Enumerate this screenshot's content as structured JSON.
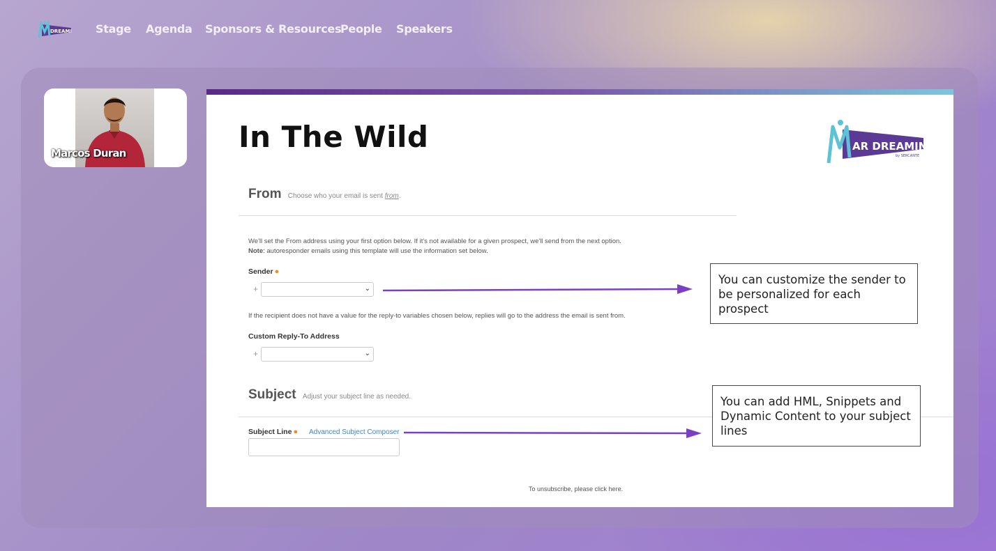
{
  "nav": {
    "logo_icon": "mar-dreamin-logo",
    "items": [
      "Stage",
      "Agenda",
      "Sponsors & Resources",
      "People",
      "Speakers"
    ]
  },
  "speaker": {
    "name": "Marcos Duran"
  },
  "slide": {
    "title": "In The Wild",
    "logo_text": "AR DREAMIN",
    "logo_byline": "by SERCANTE",
    "from": {
      "heading": "From",
      "subtitle_prefix": "Choose who your email is sent",
      "subtitle_link": "from",
      "subtitle_suffix": ".",
      "note_line1": "We'll set the From address using your first option below. If it's not available for a given prospect, we'll send from the next option.",
      "note_bold": "Note",
      "note_line2": ": autoresponder emails using this template will use the information set below.",
      "sender_label": "Sender",
      "replyto_info": "If the recipient does not have a value for the reply-to variables chosen below, replies will go to the address the email is sent from.",
      "replyto_label": "Custom Reply-To Address"
    },
    "subject": {
      "heading": "Subject",
      "subtitle": "Adjust your subject line as needed.",
      "line_label": "Subject Line",
      "composer_link": "Advanced Subject Composer"
    },
    "callouts": [
      "You can customize the sender to be personalized for each prospect",
      "You can add HML, Snippets and Dynamic Content to your subject lines"
    ],
    "footer": "To unsubscribe, please click here.",
    "colors": {
      "arrow": "#7b3fc4",
      "link": "#3b87c6",
      "required": "#e8901f"
    }
  }
}
